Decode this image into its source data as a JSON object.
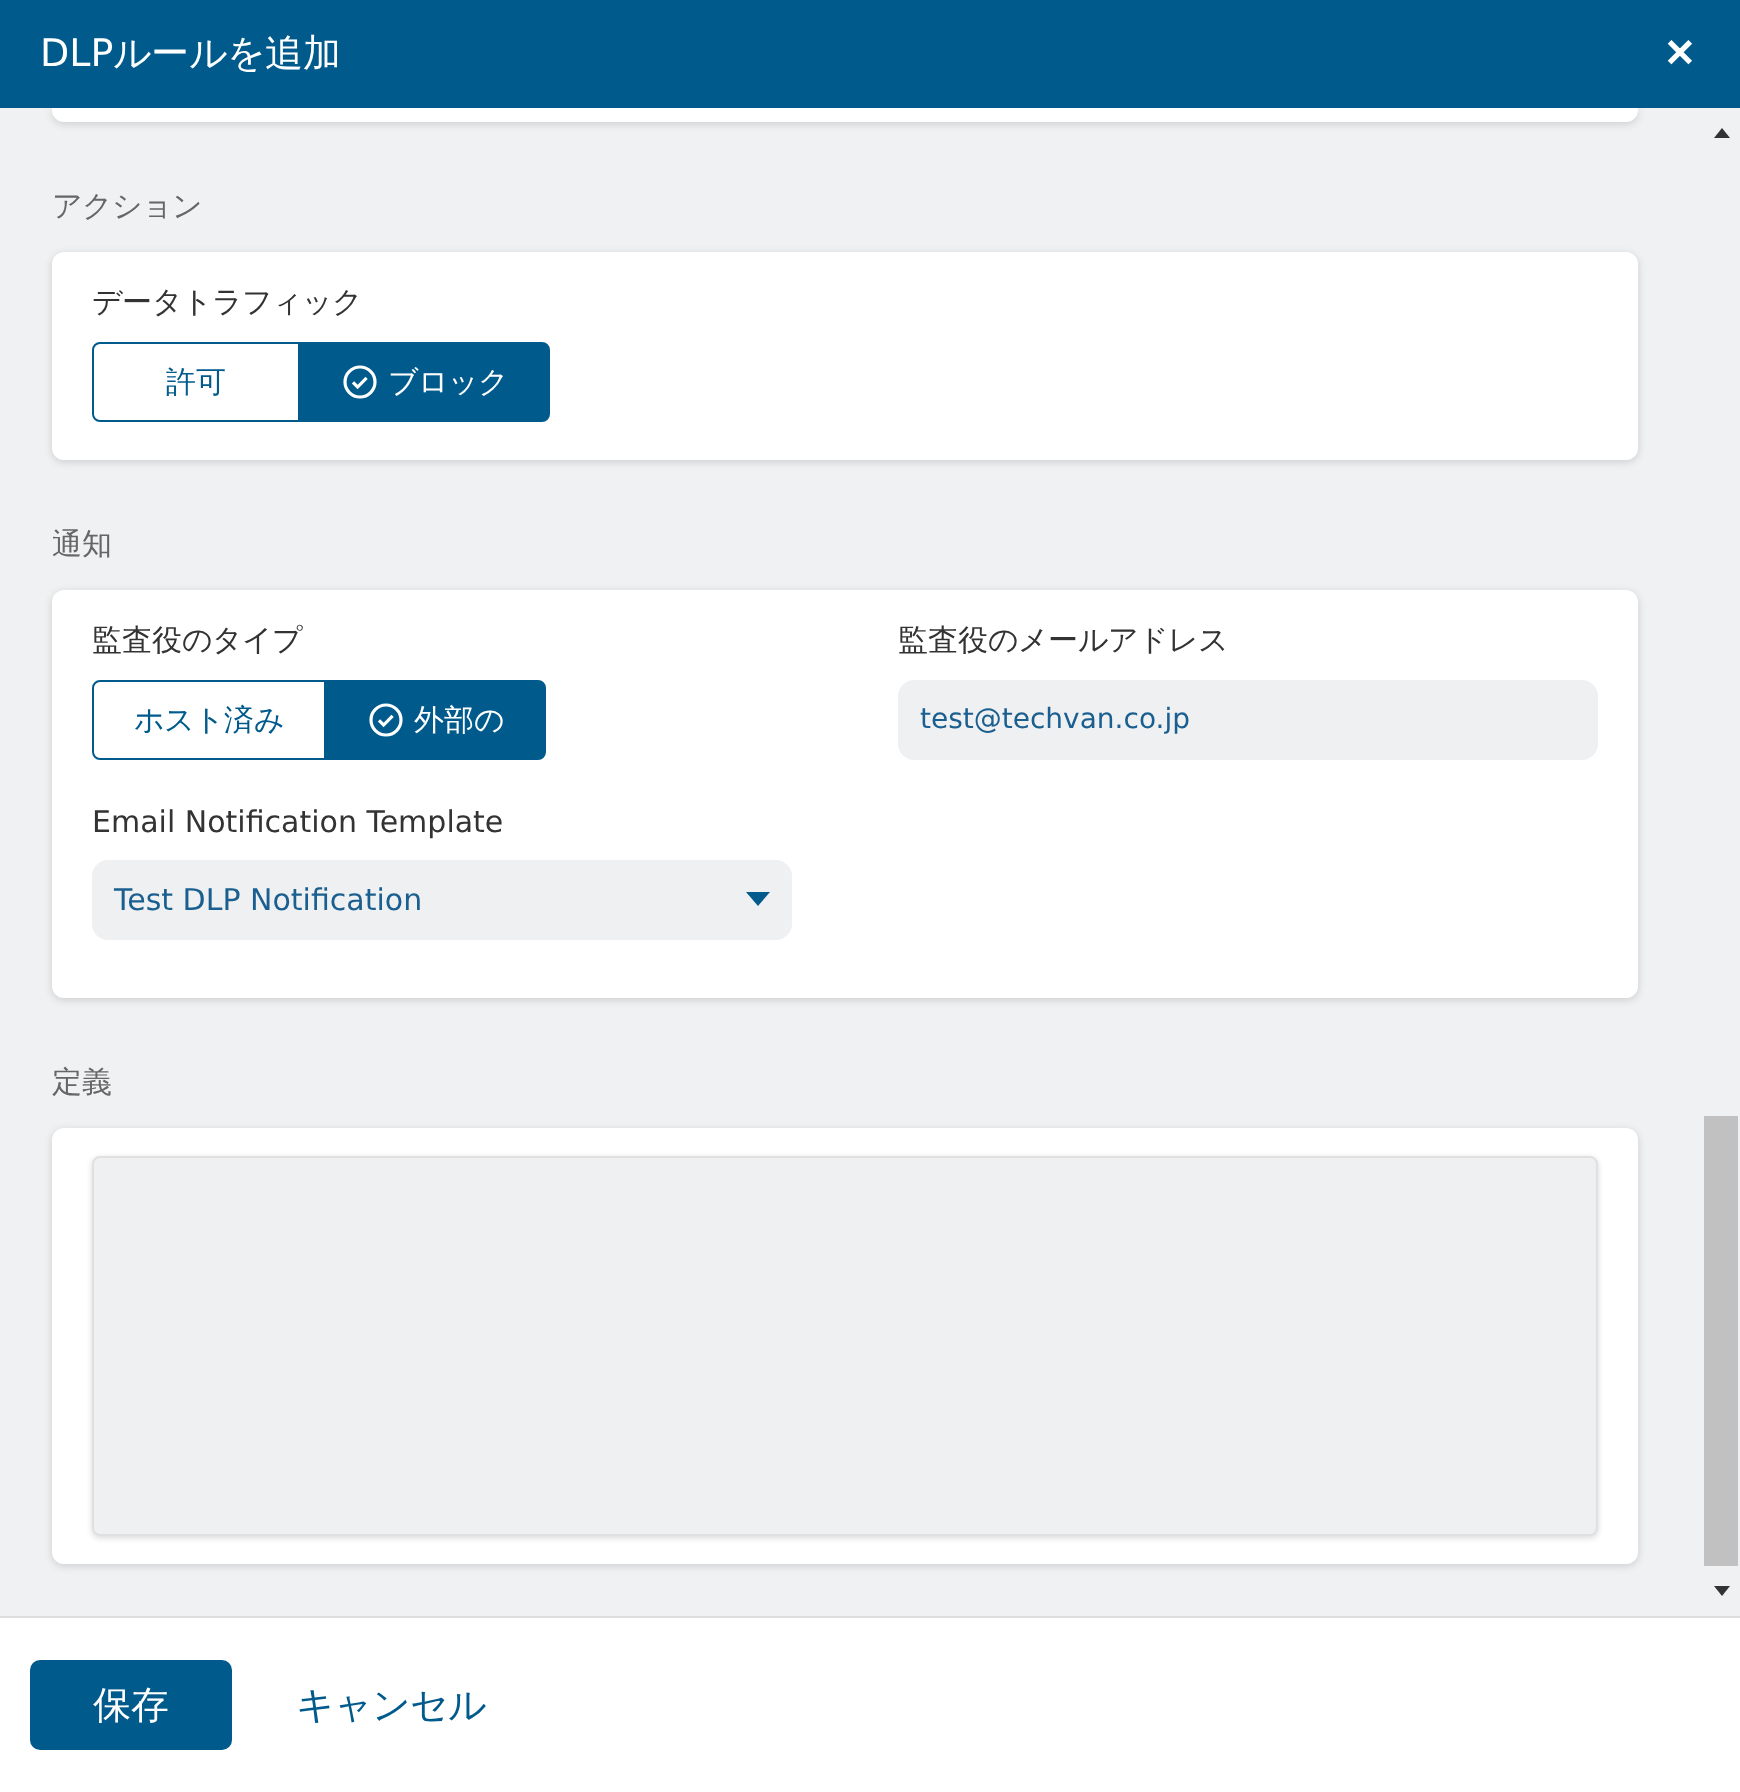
{
  "window": {
    "title": "DLPルールを追加",
    "close": "✕"
  },
  "sections": [
    {
      "kind": "traffic",
      "label": "アクション",
      "field_label": "データトラフィック",
      "options": [
        {
          "label": "許可",
          "selected": false
        },
        {
          "label": "ブロック",
          "selected": true
        }
      ]
    },
    {
      "kind": "notify",
      "label": "通知",
      "type_label": "監査役のタイプ",
      "type_options": [
        {
          "label": "ホスト済み",
          "selected": false
        },
        {
          "label": "外部の",
          "selected": true
        }
      ],
      "email_label": "監査役のメールアドレス",
      "email_value": "test@techvan.co.jp",
      "template_label": "Email Notification Template",
      "template_value": "Test DLP Notification"
    },
    {
      "kind": "definition",
      "label": "定義"
    }
  ],
  "buttons": {
    "save": "保存",
    "cancel": "キャンセル"
  }
}
